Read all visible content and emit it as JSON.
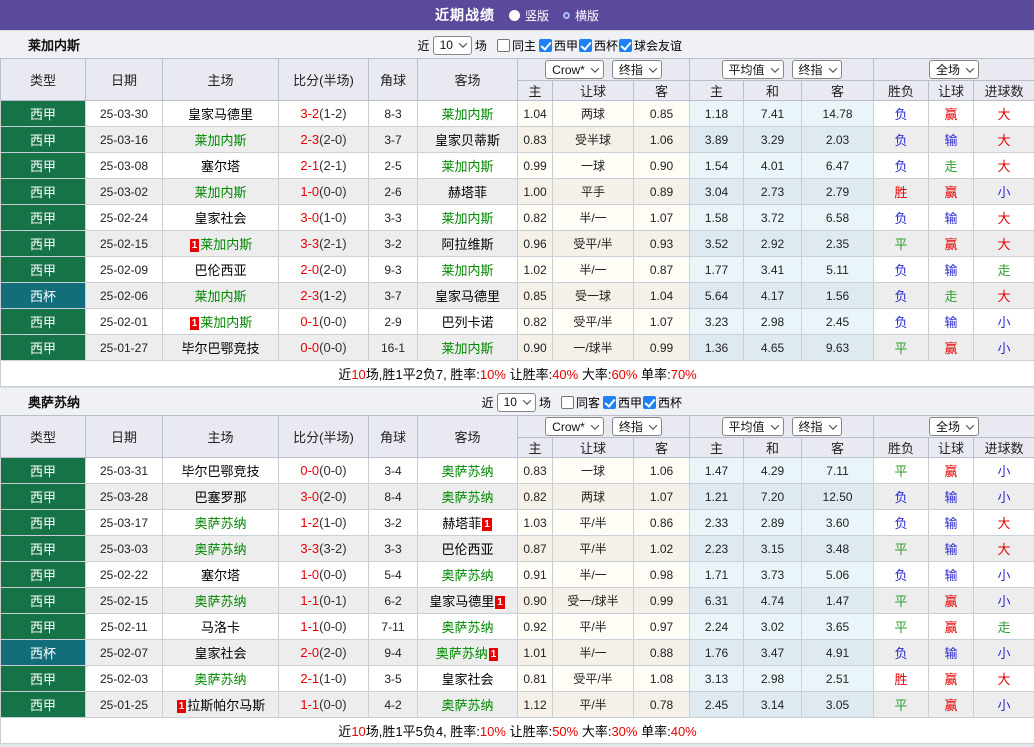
{
  "title_bar": {
    "title": "近期战绩",
    "radios": [
      {
        "label": "竖版",
        "selected": true
      },
      {
        "label": "横版",
        "selected": false
      }
    ]
  },
  "colors": {
    "bar_purple": "#5b4a9c",
    "liga_green": "#157347",
    "cup_teal": "#126e7a",
    "focus_team_green": "#008800",
    "score_red": "#e80000",
    "red": "#e80000",
    "blue": "#2a2ad0",
    "green": "#2e9e2e",
    "checkbox_blue": "#1d80f5"
  },
  "result_colors": {
    "胜": "red",
    "负": "blue",
    "平": "green",
    "赢": "red",
    "输": "blue",
    "走": "green",
    "大": "red",
    "小": "blue"
  },
  "sections": [
    {
      "team": "莱加内斯",
      "filter": {
        "prefix": "近",
        "count": "10",
        "suffix": "场",
        "same": {
          "label": "同主",
          "checked": false
        },
        "leagues": [
          {
            "label": "西甲",
            "checked": true
          },
          {
            "label": "西杯",
            "checked": true
          },
          {
            "label": "球会友谊",
            "checked": true
          }
        ]
      },
      "selects": {
        "odds": "Crow*",
        "odds_final": "终指",
        "avg": "平均值",
        "avg_final": "终指",
        "scope": "全场"
      },
      "columns": {
        "type": "类型",
        "date": "日期",
        "home": "主场",
        "score": "比分(半场)",
        "corner": "角球",
        "away": "客场",
        "o_home": "主",
        "o_hcap": "让球",
        "o_away": "客",
        "a_home": "主",
        "a_draw": "和",
        "a_away": "客",
        "r_result": "胜负",
        "r_hcap": "让球",
        "r_goals": "进球数"
      },
      "rows": [
        {
          "type": "西甲",
          "cup": false,
          "date": "25-03-30",
          "home": {
            "name": "皇家马德里"
          },
          "score": "3-2",
          "half": "(1-2)",
          "corner": "8-3",
          "away": {
            "name": "莱加内斯",
            "focus": true
          },
          "odds": [
            "1.04",
            "两球",
            "0.85"
          ],
          "avg": [
            "1.18",
            "7.41",
            "14.78"
          ],
          "result": [
            "负",
            "赢",
            "大"
          ]
        },
        {
          "type": "西甲",
          "cup": false,
          "date": "25-03-16",
          "home": {
            "name": "莱加内斯",
            "focus": true
          },
          "score": "2-3",
          "half": "(2-0)",
          "corner": "3-7",
          "away": {
            "name": "皇家贝蒂斯"
          },
          "odds": [
            "0.83",
            "受半球",
            "1.06"
          ],
          "avg": [
            "3.89",
            "3.29",
            "2.03"
          ],
          "result": [
            "负",
            "输",
            "大"
          ]
        },
        {
          "type": "西甲",
          "cup": false,
          "date": "25-03-08",
          "home": {
            "name": "塞尔塔"
          },
          "score": "2-1",
          "half": "(2-1)",
          "corner": "2-5",
          "away": {
            "name": "莱加内斯",
            "focus": true
          },
          "odds": [
            "0.99",
            "一球",
            "0.90"
          ],
          "avg": [
            "1.54",
            "4.01",
            "6.47"
          ],
          "result": [
            "负",
            "走",
            "大"
          ]
        },
        {
          "type": "西甲",
          "cup": false,
          "date": "25-03-02",
          "home": {
            "name": "莱加内斯",
            "focus": true
          },
          "score": "1-0",
          "half": "(0-0)",
          "corner": "2-6",
          "away": {
            "name": "赫塔菲"
          },
          "odds": [
            "1.00",
            "平手",
            "0.89"
          ],
          "avg": [
            "3.04",
            "2.73",
            "2.79"
          ],
          "result": [
            "胜",
            "赢",
            "小"
          ]
        },
        {
          "type": "西甲",
          "cup": false,
          "date": "25-02-24",
          "home": {
            "name": "皇家社会"
          },
          "score": "3-0",
          "half": "(1-0)",
          "corner": "3-3",
          "away": {
            "name": "莱加内斯",
            "focus": true
          },
          "odds": [
            "0.82",
            "半/一",
            "1.07"
          ],
          "avg": [
            "1.58",
            "3.72",
            "6.58"
          ],
          "result": [
            "负",
            "输",
            "大"
          ]
        },
        {
          "type": "西甲",
          "cup": false,
          "date": "25-02-15",
          "home": {
            "name": "莱加内斯",
            "focus": true,
            "badge": "1",
            "badge_pos": "before"
          },
          "score": "3-3",
          "half": "(2-1)",
          "corner": "3-2",
          "away": {
            "name": "阿拉维斯"
          },
          "odds": [
            "0.96",
            "受平/半",
            "0.93"
          ],
          "avg": [
            "3.52",
            "2.92",
            "2.35"
          ],
          "result": [
            "平",
            "赢",
            "大"
          ]
        },
        {
          "type": "西甲",
          "cup": false,
          "date": "25-02-09",
          "home": {
            "name": "巴伦西亚"
          },
          "score": "2-0",
          "half": "(2-0)",
          "corner": "9-3",
          "away": {
            "name": "莱加内斯",
            "focus": true
          },
          "odds": [
            "1.02",
            "半/一",
            "0.87"
          ],
          "avg": [
            "1.77",
            "3.41",
            "5.11"
          ],
          "result": [
            "负",
            "输",
            "走"
          ]
        },
        {
          "type": "西杯",
          "cup": true,
          "date": "25-02-06",
          "home": {
            "name": "莱加内斯",
            "focus": true
          },
          "score": "2-3",
          "half": "(1-2)",
          "corner": "3-7",
          "away": {
            "name": "皇家马德里"
          },
          "odds": [
            "0.85",
            "受一球",
            "1.04"
          ],
          "avg": [
            "5.64",
            "4.17",
            "1.56"
          ],
          "result": [
            "负",
            "走",
            "大"
          ]
        },
        {
          "type": "西甲",
          "cup": false,
          "date": "25-02-01",
          "home": {
            "name": "莱加内斯",
            "focus": true,
            "badge": "1",
            "badge_pos": "before"
          },
          "score": "0-1",
          "half": "(0-0)",
          "corner": "2-9",
          "away": {
            "name": "巴列卡诺"
          },
          "odds": [
            "0.82",
            "受平/半",
            "1.07"
          ],
          "avg": [
            "3.23",
            "2.98",
            "2.45"
          ],
          "result": [
            "负",
            "输",
            "小"
          ]
        },
        {
          "type": "西甲",
          "cup": false,
          "date": "25-01-27",
          "home": {
            "name": "毕尔巴鄂竞技"
          },
          "score": "0-0",
          "half": "(0-0)",
          "corner": "16-1",
          "away": {
            "name": "莱加内斯",
            "focus": true
          },
          "odds": [
            "0.90",
            "一/球半",
            "0.99"
          ],
          "avg": [
            "1.36",
            "4.65",
            "9.63"
          ],
          "result": [
            "平",
            "赢",
            "小"
          ]
        }
      ],
      "summary": [
        {
          "t": "近"
        },
        {
          "t": "10",
          "red": true
        },
        {
          "t": "场,胜1平2负7, 胜率:"
        },
        {
          "t": "10%",
          "red": true
        },
        {
          "t": " 让胜率:"
        },
        {
          "t": "40%",
          "red": true
        },
        {
          "t": " 大率:"
        },
        {
          "t": "60%",
          "red": true
        },
        {
          "t": " 单率:"
        },
        {
          "t": "70%",
          "red": true
        }
      ]
    },
    {
      "team": "奥萨苏纳",
      "filter": {
        "prefix": "近",
        "count": "10",
        "suffix": "场",
        "same": {
          "label": "同客",
          "checked": false
        },
        "leagues": [
          {
            "label": "西甲",
            "checked": true
          },
          {
            "label": "西杯",
            "checked": true
          }
        ]
      },
      "selects": {
        "odds": "Crow*",
        "odds_final": "终指",
        "avg": "平均值",
        "avg_final": "终指",
        "scope": "全场"
      },
      "columns": {
        "type": "类型",
        "date": "日期",
        "home": "主场",
        "score": "比分(半场)",
        "corner": "角球",
        "away": "客场",
        "o_home": "主",
        "o_hcap": "让球",
        "o_away": "客",
        "a_home": "主",
        "a_draw": "和",
        "a_away": "客",
        "r_result": "胜负",
        "r_hcap": "让球",
        "r_goals": "进球数"
      },
      "rows": [
        {
          "type": "西甲",
          "cup": false,
          "date": "25-03-31",
          "home": {
            "name": "毕尔巴鄂竞技"
          },
          "score": "0-0",
          "half": "(0-0)",
          "corner": "3-4",
          "away": {
            "name": "奥萨苏纳",
            "focus": true
          },
          "odds": [
            "0.83",
            "一球",
            "1.06"
          ],
          "avg": [
            "1.47",
            "4.29",
            "7.11"
          ],
          "result": [
            "平",
            "赢",
            "小"
          ]
        },
        {
          "type": "西甲",
          "cup": false,
          "date": "25-03-28",
          "home": {
            "name": "巴塞罗那"
          },
          "score": "3-0",
          "half": "(2-0)",
          "corner": "8-4",
          "away": {
            "name": "奥萨苏纳",
            "focus": true
          },
          "odds": [
            "0.82",
            "两球",
            "1.07"
          ],
          "avg": [
            "1.21",
            "7.20",
            "12.50"
          ],
          "result": [
            "负",
            "输",
            "小"
          ]
        },
        {
          "type": "西甲",
          "cup": false,
          "date": "25-03-17",
          "home": {
            "name": "奥萨苏纳",
            "focus": true
          },
          "score": "1-2",
          "half": "(1-0)",
          "corner": "3-2",
          "away": {
            "name": "赫塔菲",
            "badge": "1",
            "badge_pos": "after"
          },
          "odds": [
            "1.03",
            "平/半",
            "0.86"
          ],
          "avg": [
            "2.33",
            "2.89",
            "3.60"
          ],
          "result": [
            "负",
            "输",
            "大"
          ]
        },
        {
          "type": "西甲",
          "cup": false,
          "date": "25-03-03",
          "home": {
            "name": "奥萨苏纳",
            "focus": true
          },
          "score": "3-3",
          "half": "(3-2)",
          "corner": "3-3",
          "away": {
            "name": "巴伦西亚"
          },
          "odds": [
            "0.87",
            "平/半",
            "1.02"
          ],
          "avg": [
            "2.23",
            "3.15",
            "3.48"
          ],
          "result": [
            "平",
            "输",
            "大"
          ]
        },
        {
          "type": "西甲",
          "cup": false,
          "date": "25-02-22",
          "home": {
            "name": "塞尔塔"
          },
          "score": "1-0",
          "half": "(0-0)",
          "corner": "5-4",
          "away": {
            "name": "奥萨苏纳",
            "focus": true
          },
          "odds": [
            "0.91",
            "半/一",
            "0.98"
          ],
          "avg": [
            "1.71",
            "3.73",
            "5.06"
          ],
          "result": [
            "负",
            "输",
            "小"
          ]
        },
        {
          "type": "西甲",
          "cup": false,
          "date": "25-02-15",
          "home": {
            "name": "奥萨苏纳",
            "focus": true
          },
          "score": "1-1",
          "half": "(0-1)",
          "corner": "6-2",
          "away": {
            "name": "皇家马德里",
            "badge": "1",
            "badge_pos": "after"
          },
          "odds": [
            "0.90",
            "受一/球半",
            "0.99"
          ],
          "avg": [
            "6.31",
            "4.74",
            "1.47"
          ],
          "result": [
            "平",
            "赢",
            "小"
          ]
        },
        {
          "type": "西甲",
          "cup": false,
          "date": "25-02-11",
          "home": {
            "name": "马洛卡"
          },
          "score": "1-1",
          "half": "(0-0)",
          "corner": "7-11",
          "away": {
            "name": "奥萨苏纳",
            "focus": true
          },
          "odds": [
            "0.92",
            "平/半",
            "0.97"
          ],
          "avg": [
            "2.24",
            "3.02",
            "3.65"
          ],
          "result": [
            "平",
            "赢",
            "走"
          ]
        },
        {
          "type": "西杯",
          "cup": true,
          "date": "25-02-07",
          "home": {
            "name": "皇家社会"
          },
          "score": "2-0",
          "half": "(2-0)",
          "corner": "9-4",
          "away": {
            "name": "奥萨苏纳",
            "focus": true,
            "badge": "1",
            "badge_pos": "after"
          },
          "odds": [
            "1.01",
            "半/一",
            "0.88"
          ],
          "avg": [
            "1.76",
            "3.47",
            "4.91"
          ],
          "result": [
            "负",
            "输",
            "小"
          ]
        },
        {
          "type": "西甲",
          "cup": false,
          "date": "25-02-03",
          "home": {
            "name": "奥萨苏纳",
            "focus": true
          },
          "score": "2-1",
          "half": "(1-0)",
          "corner": "3-5",
          "away": {
            "name": "皇家社会"
          },
          "odds": [
            "0.81",
            "受平/半",
            "1.08"
          ],
          "avg": [
            "3.13",
            "2.98",
            "2.51"
          ],
          "result": [
            "胜",
            "赢",
            "大"
          ]
        },
        {
          "type": "西甲",
          "cup": false,
          "date": "25-01-25",
          "home": {
            "name": "拉斯帕尔马斯",
            "badge": "1",
            "badge_pos": "before"
          },
          "score": "1-1",
          "half": "(0-0)",
          "corner": "4-2",
          "away": {
            "name": "奥萨苏纳",
            "focus": true
          },
          "odds": [
            "1.12",
            "平/半",
            "0.78"
          ],
          "avg": [
            "2.45",
            "3.14",
            "3.05"
          ],
          "result": [
            "平",
            "赢",
            "小"
          ]
        }
      ],
      "summary": [
        {
          "t": "近"
        },
        {
          "t": "10",
          "red": true
        },
        {
          "t": "场,胜1平5负4, 胜率:"
        },
        {
          "t": "10%",
          "red": true
        },
        {
          "t": " 让胜率:"
        },
        {
          "t": "50%",
          "red": true
        },
        {
          "t": " 大率:"
        },
        {
          "t": "30%",
          "red": true
        },
        {
          "t": " 单率:"
        },
        {
          "t": "40%",
          "red": true
        }
      ]
    }
  ]
}
